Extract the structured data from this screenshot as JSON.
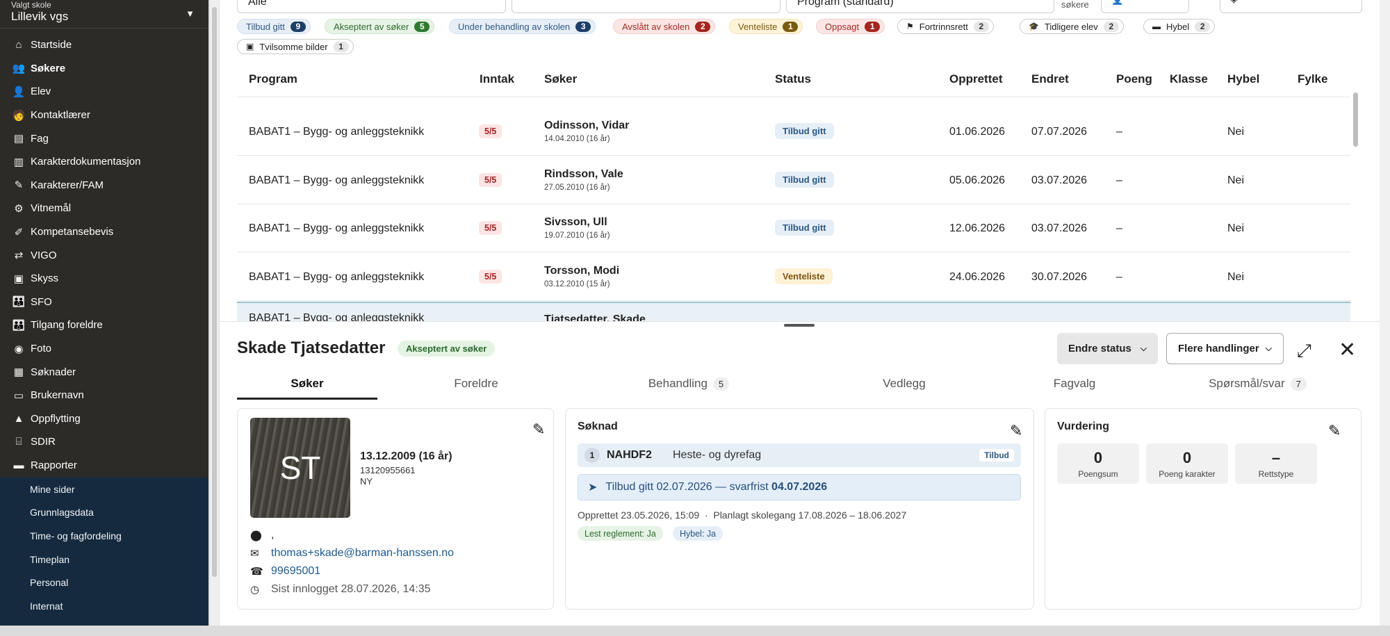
{
  "school": {
    "label": "Valgt skole",
    "value": "Lillevik vgs"
  },
  "nav": [
    {
      "icon": "home-icon",
      "label": "Startside"
    },
    {
      "icon": "applicants-icon",
      "label": "Søkere"
    },
    {
      "icon": "person-icon",
      "label": "Elev"
    },
    {
      "icon": "teacher-icon",
      "label": "Kontaktlærer"
    },
    {
      "icon": "book-icon",
      "label": "Fag"
    },
    {
      "icon": "document-icon",
      "label": "Karakterdokumentasjon"
    },
    {
      "icon": "edit-note-icon",
      "label": "Karakterer/FAM"
    },
    {
      "icon": "certificate-icon",
      "label": "Vitnemål"
    },
    {
      "icon": "competence-icon",
      "label": "Kompetansebevis"
    },
    {
      "icon": "swap-icon",
      "label": "VIGO"
    },
    {
      "icon": "bus-icon",
      "label": "Skyss"
    },
    {
      "icon": "family-icon",
      "label": "SFO"
    },
    {
      "icon": "parents-access-icon",
      "label": "Tilgang foreldre"
    },
    {
      "icon": "camera-icon",
      "label": "Foto"
    },
    {
      "icon": "files-icon",
      "label": "Søknader"
    },
    {
      "icon": "id-card-icon",
      "label": "Brukernavn"
    },
    {
      "icon": "promotion-icon",
      "label": "Oppflytting"
    },
    {
      "icon": "bank-icon",
      "label": "SDIR"
    },
    {
      "icon": "printer-icon",
      "label": "Rapporter"
    }
  ],
  "subnav": [
    "Mine sider",
    "Grunnlagsdata",
    "Time- og fagfordeling",
    "Timeplan",
    "Personal",
    "Internat"
  ],
  "filters": {
    "f1": "Alle",
    "f3": "Program (standard)",
    "sokere": "søkere"
  },
  "chips": [
    {
      "label": "Tilbud gitt",
      "count": "9",
      "tone": "blue"
    },
    {
      "label": "Akseptert av søker",
      "count": "5",
      "tone": "green"
    },
    {
      "label": "Under behandling av skolen",
      "count": "3",
      "tone": "blue"
    },
    {
      "label": "Avslått av skolen",
      "count": "2",
      "tone": "red"
    },
    {
      "label": "Venteliste",
      "count": "1",
      "tone": "yellow"
    },
    {
      "label": "Oppsagt",
      "count": "1",
      "tone": "red"
    },
    {
      "label": "Fortrinnsrett",
      "count": "2",
      "tone": "grey",
      "icon": "flag-icon"
    },
    {
      "label": "Tidligere elev",
      "count": "2",
      "tone": "grey",
      "icon": "graduation-cap-icon"
    },
    {
      "label": "Hybel",
      "count": "2",
      "tone": "grey",
      "icon": "bed-icon"
    },
    {
      "label": "Tvilsomme bilder",
      "count": "1",
      "tone": "grey",
      "icon": "image-icon"
    }
  ],
  "table": {
    "headers": [
      "Program",
      "Inntak",
      "Søker",
      "Status",
      "Opprettet",
      "Endret",
      "Poeng",
      "Klasse",
      "Hybel",
      "Fylke"
    ],
    "rows": [
      {
        "program": "BABAT1 – Bygg- og anleggsteknikk",
        "inntak": "5/5",
        "name": "Odinsson, Vidar",
        "dob": "14.04.2010 (16 år)",
        "status": "Tilbud gitt",
        "statusTone": "tilbud",
        "opprettet": "01.06.2026",
        "endret": "07.07.2026",
        "poeng": "–",
        "hybel": "Nei"
      },
      {
        "program": "BABAT1 – Bygg- og anleggsteknikk",
        "inntak": "5/5",
        "name": "Rindsson, Vale",
        "dob": "27.05.2010 (16 år)",
        "status": "Tilbud gitt",
        "statusTone": "tilbud",
        "opprettet": "05.06.2026",
        "endret": "03.07.2026",
        "poeng": "–",
        "hybel": "Nei"
      },
      {
        "program": "BABAT1 – Bygg- og anleggsteknikk",
        "inntak": "5/5",
        "name": "Sivsson, Ull",
        "dob": "19.07.2010 (16 år)",
        "status": "Tilbud gitt",
        "statusTone": "tilbud",
        "opprettet": "12.06.2026",
        "endret": "03.07.2026",
        "poeng": "–",
        "hybel": "Nei"
      },
      {
        "program": "BABAT1 – Bygg- og anleggsteknikk",
        "inntak": "5/5",
        "name": "Torsson, Modi",
        "dob": "03.12.2010 (15 år)",
        "status": "Venteliste",
        "statusTone": "vente",
        "opprettet": "24.06.2026",
        "endret": "30.07.2026",
        "poeng": "–",
        "hybel": "Nei"
      }
    ],
    "selected_name": "Tjatsedatter, Skade"
  },
  "detail": {
    "title": "Skade Tjatsedatter",
    "badge": "Akseptert av søker",
    "btn_status": "Endre status",
    "btn_more": "Flere handlinger",
    "tabs": [
      {
        "label": "Søker"
      },
      {
        "label": "Foreldre"
      },
      {
        "label": "Behandling",
        "count": "5"
      },
      {
        "label": "Vedlegg"
      },
      {
        "label": "Fagvalg"
      },
      {
        "label": "Spørsmål/svar",
        "count": "7"
      }
    ],
    "initials": "ST",
    "dob": "13.12.2009 (16 år)",
    "pnum": "13120955661",
    "ny": "NY",
    "address": ",",
    "email": "thomas+skade@barman-hanssen.no",
    "phone": "99695001",
    "last_login": "Sist innlogget 28.07.2026, 14:35",
    "soknad": {
      "title": "Søknad",
      "num": "1",
      "code": "NAHDF2",
      "program": "Heste- og dyrefag",
      "tag": "Tilbud",
      "offer_prefix": "Tilbud gitt 02.07.2026 — svarfrist ",
      "offer_deadline": "04.07.2026",
      "created": "Opprettet 23.05.2026, 15:09  ·  Planlagt skolegang 17.08.2026 – 18.06.2027",
      "tag1": "Lest reglement: Ja",
      "tag2": "Hybel: Ja"
    },
    "vurdering": {
      "title": "Vurdering",
      "boxes": [
        {
          "value": "0",
          "label": "Poengsum"
        },
        {
          "value": "0",
          "label": "Poeng karakter"
        },
        {
          "value": "–",
          "label": "Rettstype"
        }
      ]
    }
  }
}
